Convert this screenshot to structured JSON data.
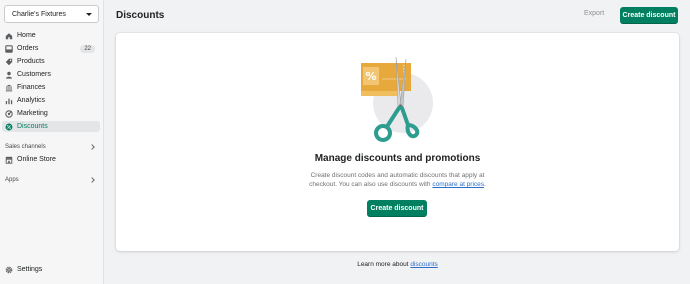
{
  "sidebar": {
    "store_name": "Charlie's Fixtures",
    "items": [
      {
        "label": "Home",
        "icon": "home-icon"
      },
      {
        "label": "Orders",
        "icon": "orders-icon",
        "badge": "22"
      },
      {
        "label": "Products",
        "icon": "products-icon"
      },
      {
        "label": "Customers",
        "icon": "customers-icon"
      },
      {
        "label": "Finances",
        "icon": "finances-icon"
      },
      {
        "label": "Analytics",
        "icon": "analytics-icon"
      },
      {
        "label": "Marketing",
        "icon": "marketing-icon"
      },
      {
        "label": "Discounts",
        "icon": "discounts-icon",
        "active": true
      }
    ],
    "sales_channels_label": "Sales channels",
    "online_store_label": "Online Store",
    "apps_label": "Apps",
    "settings_label": "Settings"
  },
  "header": {
    "title": "Discounts",
    "export_label": "Export",
    "create_label": "Create discount"
  },
  "empty_state": {
    "heading": "Manage discounts and promotions",
    "text_line1": "Create discount codes and automatic discounts that apply at",
    "text_line2_prefix": "checkout. You can also use discounts with ",
    "text_link": "compare at prices",
    "text_line2_suffix": ".",
    "button_label": "Create discount"
  },
  "footer": {
    "prefix": "Learn more about ",
    "link": "discounts"
  },
  "colors": {
    "primary": "#008060",
    "active_nav": "#007f5f",
    "link": "#2c6ecb",
    "coupon": "#e8a93c",
    "scissors": "#2d9d8f"
  }
}
